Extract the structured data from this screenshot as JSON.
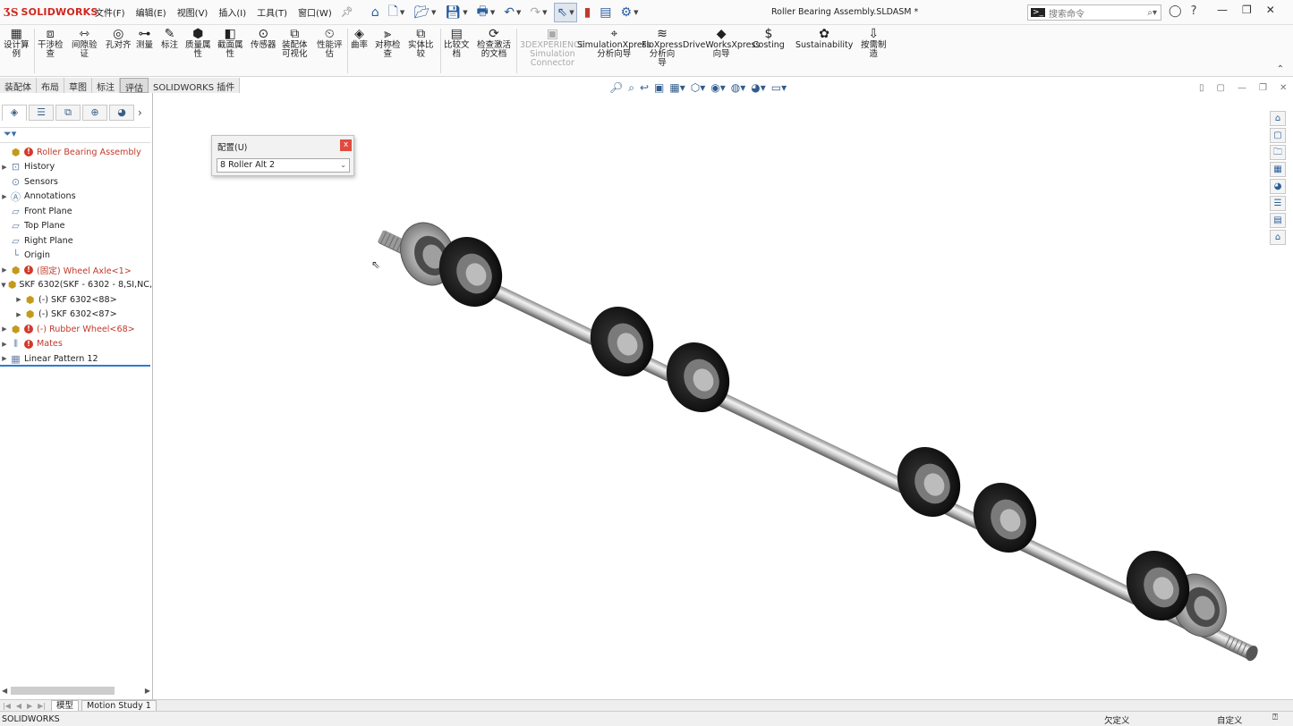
{
  "app": {
    "logo": "SOLIDWORKS",
    "document_title": "Roller Bearing Assembly.SLDASM *"
  },
  "menu": [
    "文件(F)",
    "编辑(E)",
    "视图(V)",
    "插入(I)",
    "工具(T)",
    "窗口(W)"
  ],
  "search": {
    "placeholder": "搜索命令"
  },
  "ribbon": {
    "buttons": [
      {
        "icon": "design-table-icon",
        "label": "设计算\n例"
      },
      {
        "icon": "interference-icon",
        "label": "干涉检\n查"
      },
      {
        "icon": "clearance-icon",
        "label": "间隙验\n证"
      },
      {
        "icon": "hole-align-icon",
        "label": "孔对齐"
      },
      {
        "icon": "measure-icon",
        "label": "测量"
      },
      {
        "icon": "markup-icon",
        "label": "标注"
      },
      {
        "icon": "mass-props-icon",
        "label": "质量属\n性"
      },
      {
        "icon": "section-props-icon",
        "label": "截面属\n性"
      },
      {
        "icon": "sensor-icon",
        "label": "传感器"
      },
      {
        "icon": "assembly-vis-icon",
        "label": "装配体\n可视化"
      },
      {
        "icon": "perf-eval-icon",
        "label": "性能评\n估"
      },
      {
        "icon": "curvature-icon",
        "label": "曲率"
      },
      {
        "icon": "symmetry-icon",
        "label": "对称检\n查"
      },
      {
        "icon": "compare-body-icon",
        "label": "实体比\n较"
      },
      {
        "icon": "compare-doc-icon",
        "label": "比较文\n档"
      },
      {
        "icon": "check-active-icon",
        "label": "检查激活\n的文档"
      },
      {
        "icon": "3dx-sim-icon",
        "label": "3DEXPERIENCE\nSimulation\nConnector"
      },
      {
        "icon": "simxpress-icon",
        "label": "SimulationXpress\n分析向导"
      },
      {
        "icon": "floxpress-icon",
        "label": "FloXpress\n分析向\n导"
      },
      {
        "icon": "driveworks-icon",
        "label": "DriveWorksXpress\n向导"
      },
      {
        "icon": "costing-icon",
        "label": "Costing"
      },
      {
        "icon": "sustainability-icon",
        "label": "Sustainability"
      },
      {
        "icon": "mfg-icon",
        "label": "按需制\n造"
      }
    ]
  },
  "command_tabs": [
    "装配体",
    "布局",
    "草图",
    "标注",
    "评估",
    "SOLIDWORKS 插件"
  ],
  "feature_tree": {
    "root": "Roller Bearing Assembly",
    "items": [
      {
        "label": "History"
      },
      {
        "label": "Sensors"
      },
      {
        "label": "Annotations"
      },
      {
        "label": "Front Plane"
      },
      {
        "label": "Top Plane"
      },
      {
        "label": "Right Plane"
      },
      {
        "label": "Origin"
      },
      {
        "label": "(固定) Wheel Axle<1>"
      },
      {
        "label": "SKF 6302(SKF - 6302 - 8,SI,NC,"
      },
      {
        "label": "(-) SKF 6302<88>"
      },
      {
        "label": "(-) SKF 6302<87>"
      },
      {
        "label": "(-) Rubber Wheel<68>"
      },
      {
        "label": "Mates"
      },
      {
        "label": "Linear Pattern 12"
      }
    ]
  },
  "config_popup": {
    "title": "配置(U)",
    "close": "x",
    "selected": "8 Roller Alt 2"
  },
  "bottom_tabs": [
    "模型",
    "Motion Study 1"
  ],
  "status": {
    "left": "SOLIDWORKS",
    "mid": "欠定义",
    "right": "自定义"
  },
  "colors": {
    "brand_red": "#d0271e",
    "warning_red": "#d23a2b",
    "selection_blue": "#2f7bd0"
  }
}
